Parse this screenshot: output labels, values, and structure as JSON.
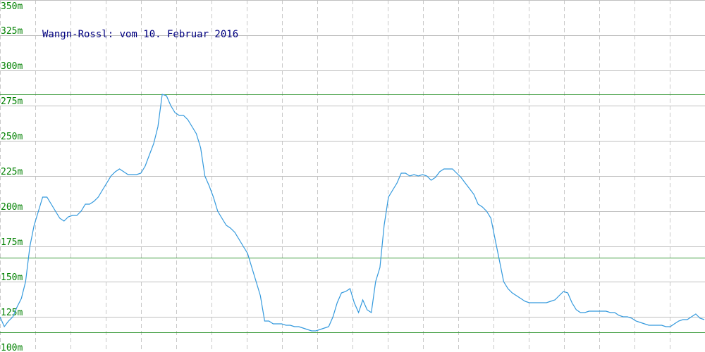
{
  "chart_data": {
    "type": "line",
    "title": "Wangn-Rossl: vom 10. Februar 2016",
    "ylim": [
      100,
      350
    ],
    "y_ticks": [
      "100m",
      "125m",
      "150m",
      "175m",
      "200m",
      "225m",
      "250m",
      "275m",
      "300m",
      "325m",
      "350m"
    ],
    "grid": true,
    "reference_lines": [
      283,
      167,
      114
    ],
    "series": [
      {
        "values": [
          125,
          118,
          122,
          125,
          132,
          138,
          150,
          175,
          190,
          200,
          210,
          210,
          205,
          200,
          195,
          193,
          196,
          197,
          197,
          200,
          205,
          205,
          207,
          210,
          215,
          220,
          225,
          228,
          230,
          228,
          226,
          226,
          226,
          227,
          232,
          240,
          248,
          260,
          283,
          282,
          275,
          270,
          268,
          268,
          265,
          260,
          255,
          245,
          225,
          218,
          210,
          200,
          195,
          190,
          188,
          185,
          180,
          175,
          170,
          160,
          150,
          140,
          122,
          122,
          120,
          120,
          120,
          119,
          119,
          118,
          118,
          117,
          116,
          115,
          115,
          116,
          117,
          118,
          125,
          135,
          142,
          143,
          145,
          135,
          128,
          137,
          130,
          128,
          150,
          160,
          190,
          210,
          215,
          220,
          227,
          227,
          225,
          226,
          225,
          226,
          225,
          222,
          224,
          228,
          230,
          230,
          230,
          227,
          224,
          220,
          216,
          212,
          205,
          203,
          200,
          195,
          180,
          165,
          150,
          145,
          142,
          140,
          138,
          136,
          135,
          135,
          135,
          135,
          135,
          136,
          137,
          140,
          143,
          142,
          135,
          130,
          128,
          128,
          129,
          129,
          129,
          129,
          129,
          128,
          128,
          126,
          125,
          125,
          124,
          122,
          121,
          120,
          119,
          119,
          119,
          119,
          118,
          118,
          120,
          122,
          123,
          123,
          125,
          127,
          124,
          123
        ]
      }
    ]
  }
}
